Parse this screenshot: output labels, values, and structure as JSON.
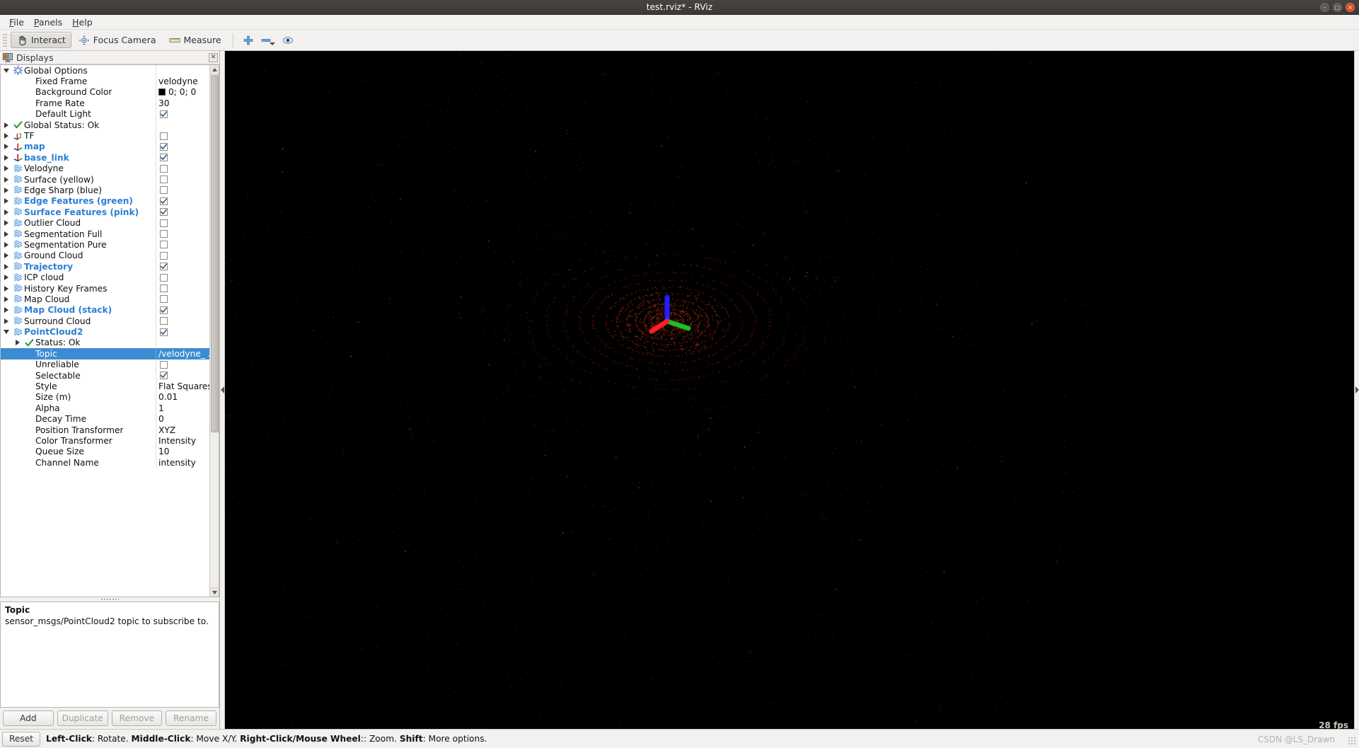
{
  "window": {
    "title": "test.rviz* - RViz",
    "buttons": {
      "minimize": "–",
      "maximize": "□",
      "close": "×"
    }
  },
  "menubar": {
    "items": [
      {
        "label": "File",
        "accel": "F"
      },
      {
        "label": "Panels",
        "accel": "P"
      },
      {
        "label": "Help",
        "accel": "H"
      }
    ]
  },
  "toolbar": {
    "interact": "Interact",
    "focus_camera": "Focus Camera",
    "measure": "Measure",
    "zoom_in_icon": "plus-icon",
    "zoom_out_icon": "minus-icon",
    "view_icon": "eye-icon"
  },
  "displays_panel": {
    "header_title": "Displays",
    "header_icon": "displays-icon",
    "close_icon": "close-icon",
    "name_column": "",
    "value_column": "",
    "rows": [
      {
        "indent": 0,
        "expander": "down",
        "icon": "gear-icon",
        "label": "Global Options",
        "bold": false,
        "value_type": "none"
      },
      {
        "indent": 1,
        "expander": "none",
        "icon": "none",
        "label": "Fixed Frame",
        "bold": false,
        "value_type": "text",
        "value": "velodyne"
      },
      {
        "indent": 1,
        "expander": "none",
        "icon": "none",
        "label": "Background Color",
        "bold": false,
        "value_type": "color",
        "value": "0; 0; 0",
        "color": "#000000"
      },
      {
        "indent": 1,
        "expander": "none",
        "icon": "none",
        "label": "Frame Rate",
        "bold": false,
        "value_type": "text",
        "value": "30"
      },
      {
        "indent": 1,
        "expander": "none",
        "icon": "none",
        "label": "Default Light",
        "bold": false,
        "value_type": "checkbox",
        "checked": true
      },
      {
        "indent": 0,
        "expander": "right",
        "icon": "check-icon",
        "label": "Global Status: Ok",
        "bold": false,
        "value_type": "none"
      },
      {
        "indent": 0,
        "expander": "right",
        "icon": "tf-icon",
        "label": "TF",
        "bold": false,
        "value_type": "checkbox",
        "checked": false
      },
      {
        "indent": 0,
        "expander": "right",
        "icon": "axes-icon",
        "label": "map",
        "bold": true,
        "value_type": "checkbox",
        "checked": true
      },
      {
        "indent": 0,
        "expander": "right",
        "icon": "axes-icon",
        "label": "base_link",
        "bold": true,
        "value_type": "checkbox",
        "checked": true
      },
      {
        "indent": 0,
        "expander": "right",
        "icon": "cloud-icon",
        "label": "Velodyne",
        "bold": false,
        "value_type": "checkbox",
        "checked": false
      },
      {
        "indent": 0,
        "expander": "right",
        "icon": "cloud-icon",
        "label": "Surface (yellow)",
        "bold": false,
        "value_type": "checkbox",
        "checked": false
      },
      {
        "indent": 0,
        "expander": "right",
        "icon": "cloud-icon",
        "label": "Edge Sharp (blue)",
        "bold": false,
        "value_type": "checkbox",
        "checked": false
      },
      {
        "indent": 0,
        "expander": "right",
        "icon": "cloud-icon",
        "label": "Edge Features (green)",
        "bold": true,
        "value_type": "checkbox",
        "checked": true
      },
      {
        "indent": 0,
        "expander": "right",
        "icon": "cloud-icon",
        "label": "Surface Features (pink)",
        "bold": true,
        "value_type": "checkbox",
        "checked": true
      },
      {
        "indent": 0,
        "expander": "right",
        "icon": "cloud-icon",
        "label": "Outlier Cloud",
        "bold": false,
        "value_type": "checkbox",
        "checked": false
      },
      {
        "indent": 0,
        "expander": "right",
        "icon": "cloud-icon",
        "label": "Segmentation Full",
        "bold": false,
        "value_type": "checkbox",
        "checked": false
      },
      {
        "indent": 0,
        "expander": "right",
        "icon": "cloud-icon",
        "label": "Segmentation Pure",
        "bold": false,
        "value_type": "checkbox",
        "checked": false
      },
      {
        "indent": 0,
        "expander": "right",
        "icon": "cloud-icon",
        "label": "Ground Cloud",
        "bold": false,
        "value_type": "checkbox",
        "checked": false
      },
      {
        "indent": 0,
        "expander": "right",
        "icon": "cloud-icon",
        "label": "Trajectory",
        "bold": true,
        "value_type": "checkbox",
        "checked": true
      },
      {
        "indent": 0,
        "expander": "right",
        "icon": "cloud-icon",
        "label": "ICP cloud",
        "bold": false,
        "value_type": "checkbox",
        "checked": false
      },
      {
        "indent": 0,
        "expander": "right",
        "icon": "cloud-icon",
        "label": "History Key Frames",
        "bold": false,
        "value_type": "checkbox",
        "checked": false
      },
      {
        "indent": 0,
        "expander": "right",
        "icon": "cloud-icon",
        "label": "Map Cloud",
        "bold": false,
        "value_type": "checkbox",
        "checked": false
      },
      {
        "indent": 0,
        "expander": "right",
        "icon": "cloud-icon",
        "label": "Map Cloud (stack)",
        "bold": true,
        "value_type": "checkbox",
        "checked": true
      },
      {
        "indent": 0,
        "expander": "right",
        "icon": "cloud-icon",
        "label": "Surround Cloud",
        "bold": false,
        "value_type": "checkbox",
        "checked": false
      },
      {
        "indent": 0,
        "expander": "down",
        "icon": "cloud-icon",
        "label": "PointCloud2",
        "bold": true,
        "value_type": "checkbox",
        "checked": true
      },
      {
        "indent": 1,
        "expander": "right",
        "icon": "check-icon",
        "label": "Status: Ok",
        "bold": false,
        "value_type": "none"
      },
      {
        "indent": 1,
        "expander": "none",
        "icon": "none",
        "label": "Topic",
        "bold": false,
        "value_type": "text",
        "value": "/velodyne_ ...",
        "selected": true
      },
      {
        "indent": 1,
        "expander": "none",
        "icon": "none",
        "label": "Unreliable",
        "bold": false,
        "value_type": "checkbox",
        "checked": false
      },
      {
        "indent": 1,
        "expander": "none",
        "icon": "none",
        "label": "Selectable",
        "bold": false,
        "value_type": "checkbox",
        "checked": true
      },
      {
        "indent": 1,
        "expander": "none",
        "icon": "none",
        "label": "Style",
        "bold": false,
        "value_type": "text",
        "value": "Flat Squares"
      },
      {
        "indent": 1,
        "expander": "none",
        "icon": "none",
        "label": "Size (m)",
        "bold": false,
        "value_type": "text",
        "value": "0.01"
      },
      {
        "indent": 1,
        "expander": "none",
        "icon": "none",
        "label": "Alpha",
        "bold": false,
        "value_type": "text",
        "value": "1"
      },
      {
        "indent": 1,
        "expander": "none",
        "icon": "none",
        "label": "Decay Time",
        "bold": false,
        "value_type": "text",
        "value": "0"
      },
      {
        "indent": 1,
        "expander": "none",
        "icon": "none",
        "label": "Position Transformer",
        "bold": false,
        "value_type": "text",
        "value": "XYZ"
      },
      {
        "indent": 1,
        "expander": "none",
        "icon": "none",
        "label": "Color Transformer",
        "bold": false,
        "value_type": "text",
        "value": "Intensity"
      },
      {
        "indent": 1,
        "expander": "none",
        "icon": "none",
        "label": "Queue Size",
        "bold": false,
        "value_type": "text",
        "value": "10"
      },
      {
        "indent": 1,
        "expander": "none",
        "icon": "none",
        "label": "Channel Name",
        "bold": false,
        "value_type": "text",
        "value": "intensity"
      }
    ]
  },
  "description": {
    "title": "Topic",
    "body": "sensor_msgs/PointCloud2 topic to subscribe to."
  },
  "display_buttons": {
    "add": "Add",
    "duplicate": "Duplicate",
    "remove": "Remove",
    "rename": "Rename"
  },
  "viewport": {
    "fps": "28 fps",
    "background_color": "#000000"
  },
  "statusbar": {
    "reset": "Reset",
    "hint_parts": [
      {
        "text": "Left-Click",
        "bold": true
      },
      {
        "text": ": Rotate.  ",
        "bold": false
      },
      {
        "text": "Middle-Click",
        "bold": true
      },
      {
        "text": ": Move X/Y.  ",
        "bold": false
      },
      {
        "text": "Right-Click/Mouse Wheel",
        "bold": true
      },
      {
        "text": ":: Zoom.  ",
        "bold": false
      },
      {
        "text": "Shift",
        "bold": true
      },
      {
        "text": ": More options.",
        "bold": false
      }
    ],
    "watermark": "CSDN @LS_Drawn"
  },
  "colors": {
    "accent_blue": "#2a7fd4",
    "selection_blue": "#3c8cd2",
    "panel_bg": "#f2f1f0",
    "viewport_bg": "#000000",
    "axis_x": "#ff2020",
    "axis_y": "#20c020",
    "axis_z": "#2020ff",
    "point_red": "#d03018",
    "point_green": "#20b020"
  }
}
